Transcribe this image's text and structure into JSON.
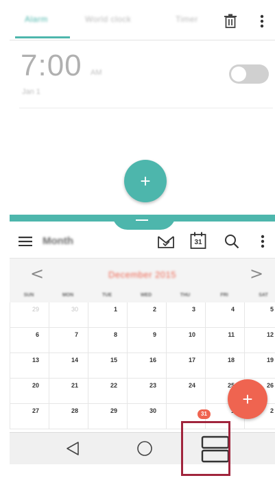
{
  "clock": {
    "tabs": [
      {
        "label": "Alarm",
        "active": true
      },
      {
        "label": "World clock",
        "active": false
      },
      {
        "label": "Timer",
        "active": false
      }
    ],
    "icons": {
      "delete": "trash-icon",
      "more": "more-vert-icon"
    },
    "alarm": {
      "time": "7:00",
      "ampm": "AM",
      "date": "Jan 1",
      "enabled": false
    },
    "fab_label": "+"
  },
  "calendar": {
    "title": "Month",
    "icons": {
      "tasks": "mail-task-icon",
      "today": "calendar-today-icon",
      "today_number": "31",
      "search": "search-icon",
      "more": "more-vert-icon",
      "menu": "hamburger-menu-icon"
    },
    "month_label": "December 2015",
    "prev_arrow": "<",
    "next_arrow": ">",
    "weekdays": [
      "SUN",
      "MON",
      "TUE",
      "WED",
      "THU",
      "FRI",
      "SAT"
    ],
    "weeks": [
      [
        "29",
        "30",
        "1",
        "2",
        "3",
        "4",
        "5"
      ],
      [
        "6",
        "7",
        "8",
        "9",
        "10",
        "11",
        "12"
      ],
      [
        "13",
        "14",
        "15",
        "16",
        "17",
        "18",
        "19"
      ],
      [
        "20",
        "21",
        "22",
        "23",
        "24",
        "25",
        "26"
      ],
      [
        "27",
        "28",
        "29",
        "30",
        "31",
        "1",
        "2"
      ]
    ],
    "today": "31",
    "fab_label": "+"
  },
  "navbar": {
    "back": "back-triangle-icon",
    "home": "home-circle-icon",
    "split": "split-window-icon"
  },
  "colors": {
    "accent_teal": "#4db6ac",
    "accent_red": "#ef6450",
    "highlight": "#a0243c"
  }
}
